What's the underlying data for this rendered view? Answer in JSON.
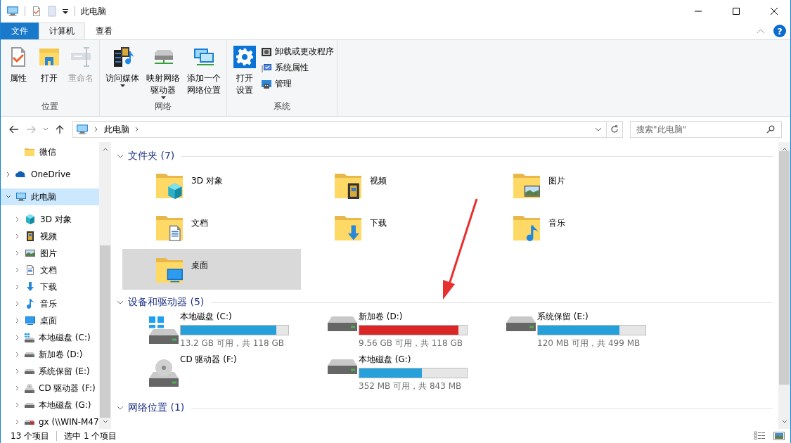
{
  "window": {
    "title": "此电脑"
  },
  "ribbon_tabs": [
    {
      "label": "文件",
      "kind": "file",
      "selected": false
    },
    {
      "label": "计算机",
      "kind": "tab",
      "selected": true
    },
    {
      "label": "查看",
      "kind": "tab",
      "selected": false
    }
  ],
  "help": "?",
  "ribbon_groups": [
    {
      "label": "位置",
      "large": [
        {
          "lines": [
            "属性"
          ],
          "kind": "props",
          "disabled": false,
          "dropdown": false
        },
        {
          "lines": [
            "打开"
          ],
          "kind": "open",
          "disabled": false,
          "dropdown": false
        },
        {
          "lines": [
            "重命名"
          ],
          "kind": "rename",
          "disabled": true,
          "dropdown": false
        }
      ]
    },
    {
      "label": "网络",
      "large": [
        {
          "lines": [
            "访问媒体"
          ],
          "kind": "media",
          "disabled": false,
          "dropdown": true
        },
        {
          "lines": [
            "映射网络",
            "驱动器"
          ],
          "kind": "mapdrive",
          "disabled": false,
          "dropdown": true
        },
        {
          "lines": [
            "添加一个",
            "网络位置"
          ],
          "kind": "addnet",
          "disabled": false,
          "dropdown": false
        }
      ]
    },
    {
      "label": "系统",
      "large": [
        {
          "lines": [
            "打开",
            "设置"
          ],
          "kind": "gear",
          "disabled": false,
          "dropdown": false
        }
      ],
      "small": [
        {
          "label": "卸载或更改程序",
          "kind": "uninstall"
        },
        {
          "label": "系统属性",
          "kind": "sysprop"
        },
        {
          "label": "管理",
          "kind": "manage"
        }
      ]
    }
  ],
  "address": {
    "path": [
      "此电脑"
    ],
    "search_placeholder": "搜索\"此电脑\""
  },
  "nav_tree": [
    {
      "label": "微信",
      "kind": "folder",
      "expandable": false,
      "selected": false
    },
    {
      "label": "OneDrive",
      "kind": "cloud",
      "expandable": true,
      "expanded": false,
      "selected": false
    },
    {
      "label": "此电脑",
      "kind": "pc",
      "expandable": true,
      "expanded": true,
      "selected": true,
      "children": [
        {
          "label": "3D 对象",
          "kind": "cube",
          "expandable": true,
          "expanded": false,
          "selected": false
        },
        {
          "label": "视频",
          "kind": "film",
          "expandable": true,
          "expanded": false,
          "selected": false
        },
        {
          "label": "图片",
          "kind": "picture",
          "expandable": true,
          "expanded": false,
          "selected": false
        },
        {
          "label": "文档",
          "kind": "doc",
          "expandable": true,
          "expanded": false,
          "selected": false
        },
        {
          "label": "下载",
          "kind": "download",
          "expandable": true,
          "expanded": false,
          "selected": false
        },
        {
          "label": "音乐",
          "kind": "music",
          "expandable": true,
          "expanded": false,
          "selected": false
        },
        {
          "label": "桌面",
          "kind": "desktop",
          "expandable": true,
          "expanded": false,
          "selected": false
        },
        {
          "label": "本地磁盘 (C:)",
          "kind": "drivewin",
          "expandable": true,
          "expanded": false,
          "selected": false
        },
        {
          "label": "新加卷 (D:)",
          "kind": "drive",
          "expandable": true,
          "expanded": false,
          "selected": false
        },
        {
          "label": "系统保留 (E:)",
          "kind": "drive",
          "expandable": true,
          "expanded": false,
          "selected": false
        },
        {
          "label": "CD 驱动器 (F:)",
          "kind": "cd",
          "expandable": true,
          "expanded": false,
          "selected": false
        },
        {
          "label": "本地磁盘 (G:)",
          "kind": "drive",
          "expandable": true,
          "expanded": false,
          "selected": false
        },
        {
          "label": "gx (\\\\WIN-M47",
          "kind": "netdrive",
          "expandable": true,
          "expanded": false,
          "selected": false
        }
      ]
    }
  ],
  "sections": [
    {
      "title": "文件夹 (7)",
      "kind": "folders",
      "expanded": true,
      "items": [
        {
          "label": "3D 对象",
          "kind": "cube",
          "selected": false
        },
        {
          "label": "视频",
          "kind": "film",
          "selected": false
        },
        {
          "label": "图片",
          "kind": "picture",
          "selected": false
        },
        {
          "label": "文档",
          "kind": "doc",
          "selected": false
        },
        {
          "label": "下载",
          "kind": "download",
          "selected": false
        },
        {
          "label": "音乐",
          "kind": "music",
          "selected": false
        },
        {
          "label": "桌面",
          "kind": "desktop",
          "selected": true
        }
      ]
    },
    {
      "title": "设备和驱动器 (5)",
      "kind": "drives",
      "expanded": true,
      "items": [
        {
          "label": "本地磁盘 (C:)",
          "kind": "drivewin",
          "level": 0.89,
          "color": "#26a0da",
          "reading": "13.2 GB 可用，共 118 GB"
        },
        {
          "label": "新加卷 (D:)",
          "kind": "drive",
          "level": 0.92,
          "color": "#da2626",
          "reading": "9.56 GB 可用，共 118 GB"
        },
        {
          "label": "系统保留 (E:)",
          "kind": "drive",
          "level": 0.76,
          "color": "#26a0da",
          "reading": "120 MB 可用，共 499 MB"
        },
        {
          "label": "CD 驱动器 (F:)",
          "kind": "cd"
        },
        {
          "label": "本地磁盘 (G:)",
          "kind": "drive",
          "level": 0.58,
          "color": "#26a0da",
          "reading": "352 MB 可用，共 843 MB"
        }
      ]
    },
    {
      "title": "网络位置 (1)",
      "kind": "network",
      "expanded": true
    }
  ],
  "status": {
    "count": "13 个项目",
    "selection": "选中 1 个项目"
  }
}
